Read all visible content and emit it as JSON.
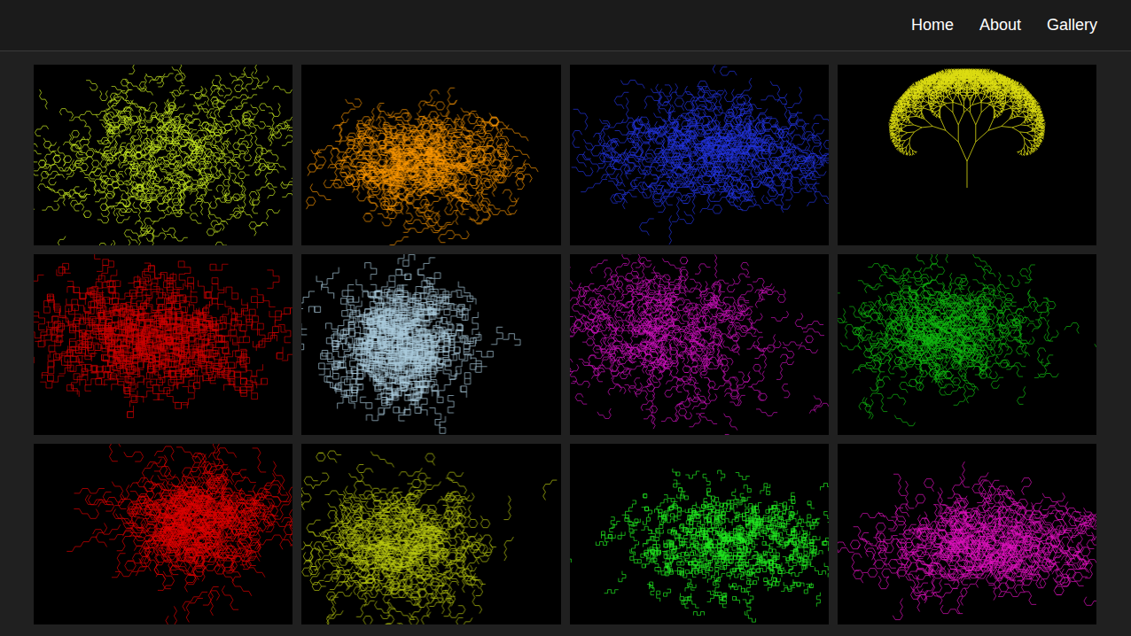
{
  "nav": [
    {
      "label": "Home"
    },
    {
      "label": "About"
    },
    {
      "label": "Gallery"
    }
  ],
  "gallery": [
    {
      "kind": "walk",
      "color": "#ccee22"
    },
    {
      "kind": "walk",
      "color": "#ff9900"
    },
    {
      "kind": "walk",
      "color": "#2233dd"
    },
    {
      "kind": "tree",
      "color": "#dddd11"
    },
    {
      "kind": "walk",
      "color": "#cc0000"
    },
    {
      "kind": "walk",
      "color": "#aaccdd"
    },
    {
      "kind": "walk",
      "color": "#cc11bb"
    },
    {
      "kind": "walk",
      "color": "#11bb11"
    },
    {
      "kind": "walk",
      "color": "#dd0000"
    },
    {
      "kind": "walk",
      "color": "#bbcc11"
    },
    {
      "kind": "walk",
      "color": "#22ee22"
    },
    {
      "kind": "walk",
      "color": "#dd11bb"
    }
  ]
}
